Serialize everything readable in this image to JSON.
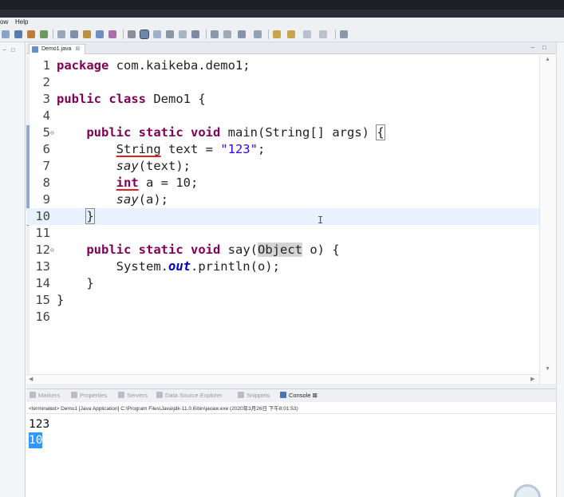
{
  "menubar": {
    "items": [
      "ow",
      "Help"
    ]
  },
  "editor_tab": {
    "label": "Demo1.java",
    "close": "⊠"
  },
  "code_lines": [
    {
      "num": "1",
      "fold": "",
      "code": [
        {
          "t": "package",
          "c": "kw"
        },
        {
          "t": " com.kaikeba.demo1;"
        }
      ]
    },
    {
      "num": "2",
      "fold": "",
      "code": []
    },
    {
      "num": "3",
      "fold": "",
      "code": [
        {
          "t": "public",
          "c": "kw"
        },
        {
          "t": " "
        },
        {
          "t": "class",
          "c": "kw"
        },
        {
          "t": " Demo1 {"
        }
      ]
    },
    {
      "num": "4",
      "fold": "",
      "code": []
    },
    {
      "num": "5",
      "fold": "⊖",
      "code": [
        {
          "t": "    "
        },
        {
          "t": "public",
          "c": "kw"
        },
        {
          "t": " "
        },
        {
          "t": "static",
          "c": "kw"
        },
        {
          "t": " "
        },
        {
          "t": "void",
          "c": "kw"
        },
        {
          "t": " main(String[] args) "
        },
        {
          "t": "{",
          "c": "brace"
        }
      ]
    },
    {
      "num": "6",
      "fold": "",
      "code": [
        {
          "t": "        "
        },
        {
          "t": "String",
          "c": "err"
        },
        {
          "t": " text = "
        },
        {
          "t": "\"123\"",
          "c": "str"
        },
        {
          "t": ";"
        }
      ]
    },
    {
      "num": "7",
      "fold": "",
      "code": [
        {
          "t": "        "
        },
        {
          "t": "say",
          "c": "italic"
        },
        {
          "t": "(text);"
        }
      ]
    },
    {
      "num": "8",
      "fold": "",
      "code": [
        {
          "t": "        "
        },
        {
          "t": "int",
          "c": "kw err"
        },
        {
          "t": " a = 10;"
        }
      ]
    },
    {
      "num": "9",
      "fold": "",
      "code": [
        {
          "t": "        "
        },
        {
          "t": "say",
          "c": "italic"
        },
        {
          "t": "(a);"
        }
      ]
    },
    {
      "num": "10",
      "fold": "",
      "current": true,
      "code": [
        {
          "t": "    "
        },
        {
          "t": "}",
          "c": "brace"
        },
        {
          "caret": true
        }
      ]
    },
    {
      "num": "11",
      "fold": "",
      "code": []
    },
    {
      "num": "12",
      "fold": "⊖",
      "code": [
        {
          "t": "    "
        },
        {
          "t": "public",
          "c": "kw"
        },
        {
          "t": " "
        },
        {
          "t": "static",
          "c": "kw"
        },
        {
          "t": " "
        },
        {
          "t": "void",
          "c": "kw"
        },
        {
          "t": " say("
        },
        {
          "t": "Object",
          "c": "hl"
        },
        {
          "t": " o) {"
        }
      ]
    },
    {
      "num": "13",
      "fold": "",
      "code": [
        {
          "t": "        System."
        },
        {
          "t": "out",
          "c": "field"
        },
        {
          "t": ".println(o);"
        }
      ]
    },
    {
      "num": "14",
      "fold": "",
      "code": [
        {
          "t": "    }"
        }
      ]
    },
    {
      "num": "15",
      "fold": "",
      "code": [
        {
          "t": "}"
        }
      ]
    },
    {
      "num": "16",
      "fold": "",
      "code": []
    }
  ],
  "cursor_glyph": "I",
  "console_tabs": [
    {
      "label": "Markers",
      "active": false
    },
    {
      "label": "Properties",
      "active": false
    },
    {
      "label": "Servers",
      "active": false
    },
    {
      "label": "Data Source Explorer",
      "active": false
    },
    {
      "label": "Snippets",
      "active": false
    },
    {
      "label": "Console ⊠",
      "active": true
    }
  ],
  "console_status": "<terminated> Demo1 [Java Application] C:\\Program Files\\Java\\jdk-11.0.6\\bin\\javaw.exe (2020年3月26日 下午8:01:53)",
  "console_output": [
    {
      "text": "123",
      "selected": false
    },
    {
      "text": "10",
      "selected": true
    }
  ],
  "colors": {
    "keyword": "#7f0055",
    "string": "#2a00ff",
    "field": "#0000c0",
    "current_line": "#e8f2fe",
    "selection": "#3297fd",
    "error_underline": "#e0201d"
  },
  "icons": [
    "file-java-icon",
    "minimize-icon",
    "maximize-icon",
    "fold-collapse-icon",
    "text-cursor-icon",
    "markers-icon",
    "properties-icon",
    "servers-icon",
    "data-source-icon",
    "snippets-icon",
    "console-icon"
  ]
}
